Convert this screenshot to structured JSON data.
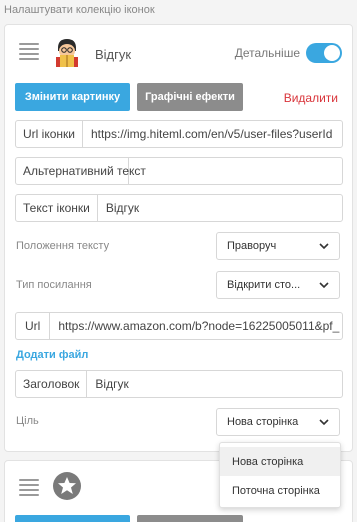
{
  "header": {
    "title": "Налаштувати колекцію іконок"
  },
  "item1": {
    "title": "Відгук",
    "details_label": "Детальніше",
    "details_on": true,
    "change_image_label": "Змінити картинку",
    "effects_label": "Графічні ефекти",
    "delete_label": "Видалити",
    "icon_url": {
      "label": "Url іконки",
      "value": "https://img.hiteml.com/en/v5/user-files?userId"
    },
    "alt_text": {
      "label": "Альтернативний текст",
      "value": ""
    },
    "icon_text": {
      "label": "Текст іконки",
      "value": "Відгук"
    },
    "text_position": {
      "label": "Положення тексту",
      "value": "Праворуч"
    },
    "link_type": {
      "label": "Тип посилання",
      "value": "Відкрити сто..."
    },
    "url": {
      "label": "Url",
      "value": "https://www.amazon.com/b?node=16225005011&pf_"
    },
    "add_file_label": "Додати файл",
    "heading": {
      "label": "Заголовок",
      "value": "Відгук"
    },
    "target": {
      "label": "Ціль",
      "value": "Нова сторінка"
    },
    "target_options": [
      "Нова сторінка",
      "Поточна сторінка"
    ]
  },
  "icons": {
    "drag": "drag-handle-icon",
    "chevron": "chevron-down-icon",
    "thumb1": "reader-avatar-icon",
    "thumb2": "star-icon"
  },
  "colors": {
    "accent": "#3aa7e0",
    "gray_button": "#8c8c8c",
    "danger": "#d9343a"
  }
}
